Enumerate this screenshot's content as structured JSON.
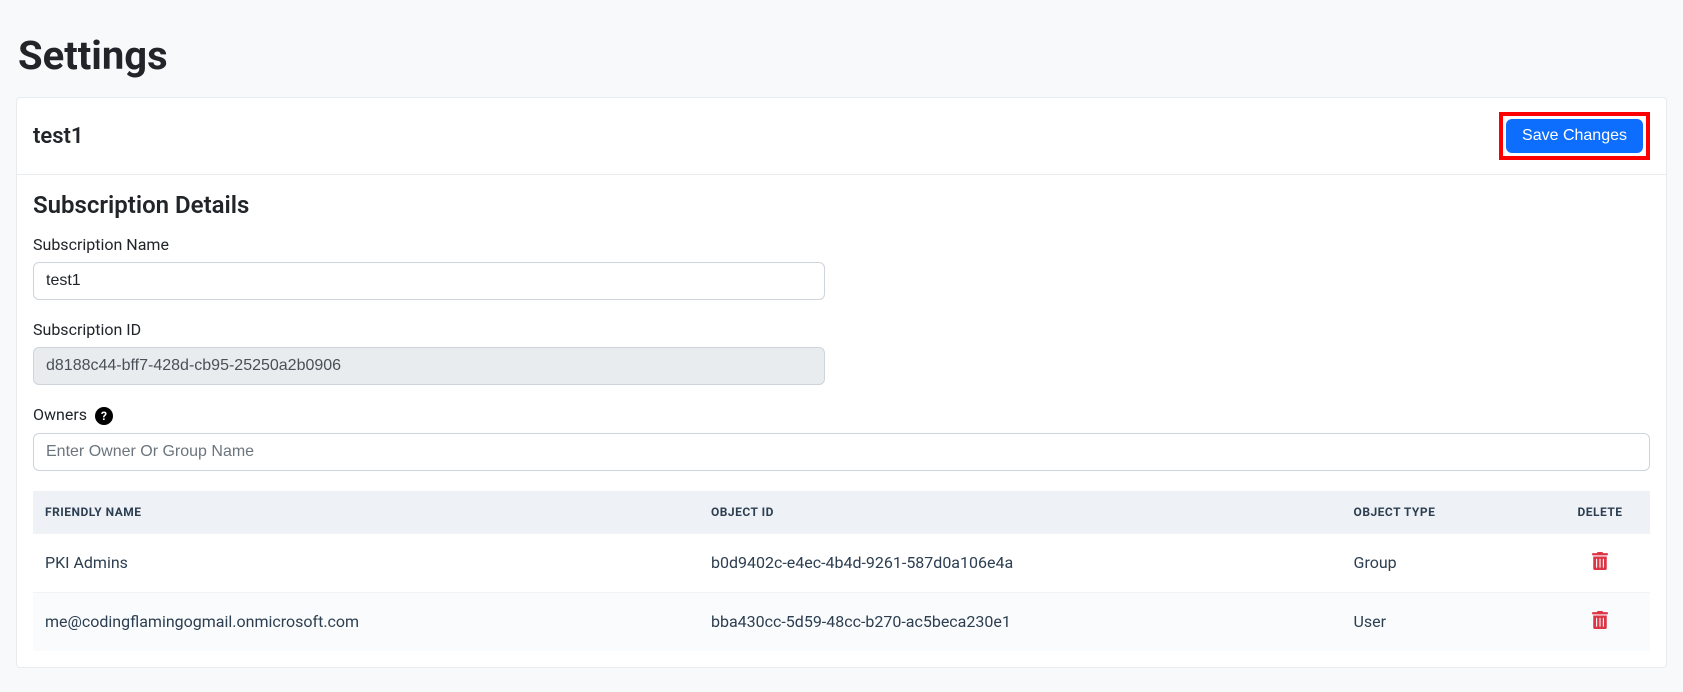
{
  "pageTitle": "Settings",
  "header": {
    "title": "test1",
    "saveButton": "Save Changes"
  },
  "details": {
    "sectionTitle": "Subscription Details",
    "nameLabel": "Subscription Name",
    "nameValue": "test1",
    "idLabel": "Subscription ID",
    "idValue": "d8188c44-bff7-428d-cb95-25250a2b0906",
    "ownersLabel": "Owners",
    "ownersPlaceholder": "Enter Owner Or Group Name"
  },
  "ownersTable": {
    "columns": {
      "friendlyName": "Friendly Name",
      "objectId": "Object ID",
      "objectType": "Object Type",
      "delete": "Delete"
    },
    "rows": [
      {
        "friendlyName": "PKI Admins",
        "objectId": "b0d9402c-e4ec-4b4d-9261-587d0a106e4a",
        "objectType": "Group"
      },
      {
        "friendlyName": "me@codingflamingogmail.onmicrosoft.com",
        "objectId": "bba430cc-5d59-48cc-b270-ac5beca230e1",
        "objectType": "User"
      }
    ]
  }
}
